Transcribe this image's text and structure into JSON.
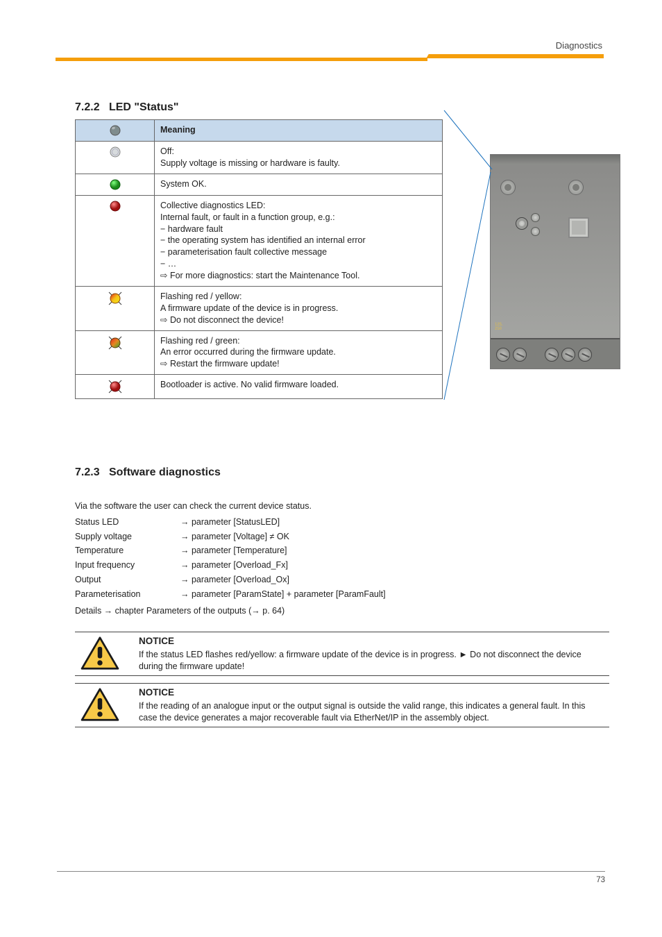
{
  "header": {
    "chapter": "Diagnostics"
  },
  "sections": {
    "led_status": {
      "number": "7.2.2",
      "title": "LED \"Status\""
    },
    "sw_diag": {
      "number": "7.2.3",
      "title": "Software diagnostics"
    }
  },
  "table": {
    "header": {
      "meaning": "Meaning"
    },
    "rows": [
      {
        "line1": "Off:",
        "line2": "Supply voltage is missing or hardware is faulty."
      },
      {
        "line1": "System OK."
      },
      {
        "line1": "Collective diagnostics LED:",
        "line2": "Internal fault, or fault in a function group, e.g.:",
        "line3": "−  hardware fault",
        "line4": "−  the operating system has identified an internal error",
        "line5": "−  parameterisation fault collective message",
        "line6": "−  …",
        "line7": "⇨ For more diagnostics: start the Maintenance Tool."
      },
      {
        "line1": "Flashing red / yellow:",
        "line2": "A firmware update of the device is in progress.",
        "line3": "⇨ Do not disconnect the device!"
      },
      {
        "line1": "Flashing red / green:",
        "line2": "An error occurred during the firmware update.",
        "line3": "⇨ Restart the firmware update!"
      },
      {
        "line1": "Bootloader is active. No valid firmware loaded."
      }
    ]
  },
  "diag": {
    "intro": "Via the software the user can check the current device status.",
    "items": [
      {
        "label": "Status LED",
        "value": "→ parameter [StatusLED]"
      },
      {
        "label": "Supply voltage",
        "value": "→ parameter [Voltage] ≠ OK"
      },
      {
        "label": "Temperature",
        "value": "→ parameter [Temperature]"
      },
      {
        "label": "Input frequency",
        "value": "→ parameter [Overload_Fx]"
      },
      {
        "label": "Output",
        "value": "→ parameter [Overload_Ox]"
      },
      {
        "label": "Parameterisation",
        "value": "→ parameter [ParamState] + parameter [ParamFault]"
      }
    ],
    "note": "Details → chapter Parameters of the outputs (→ p. 64)"
  },
  "notices": [
    {
      "title": "NOTICE",
      "body": "If the status LED flashes red/yellow: a firmware update of the device is in progress.\n► Do not disconnect the device during the firmware update!"
    },
    {
      "title": "NOTICE",
      "body": "If the reading of an analogue input or the output signal is outside the valid range, this indicates a general fault. In this case the device generates a major recoverable fault via EtherNet/IP in the assembly object."
    }
  ],
  "footer": {
    "doc_id": "",
    "page": "73"
  }
}
